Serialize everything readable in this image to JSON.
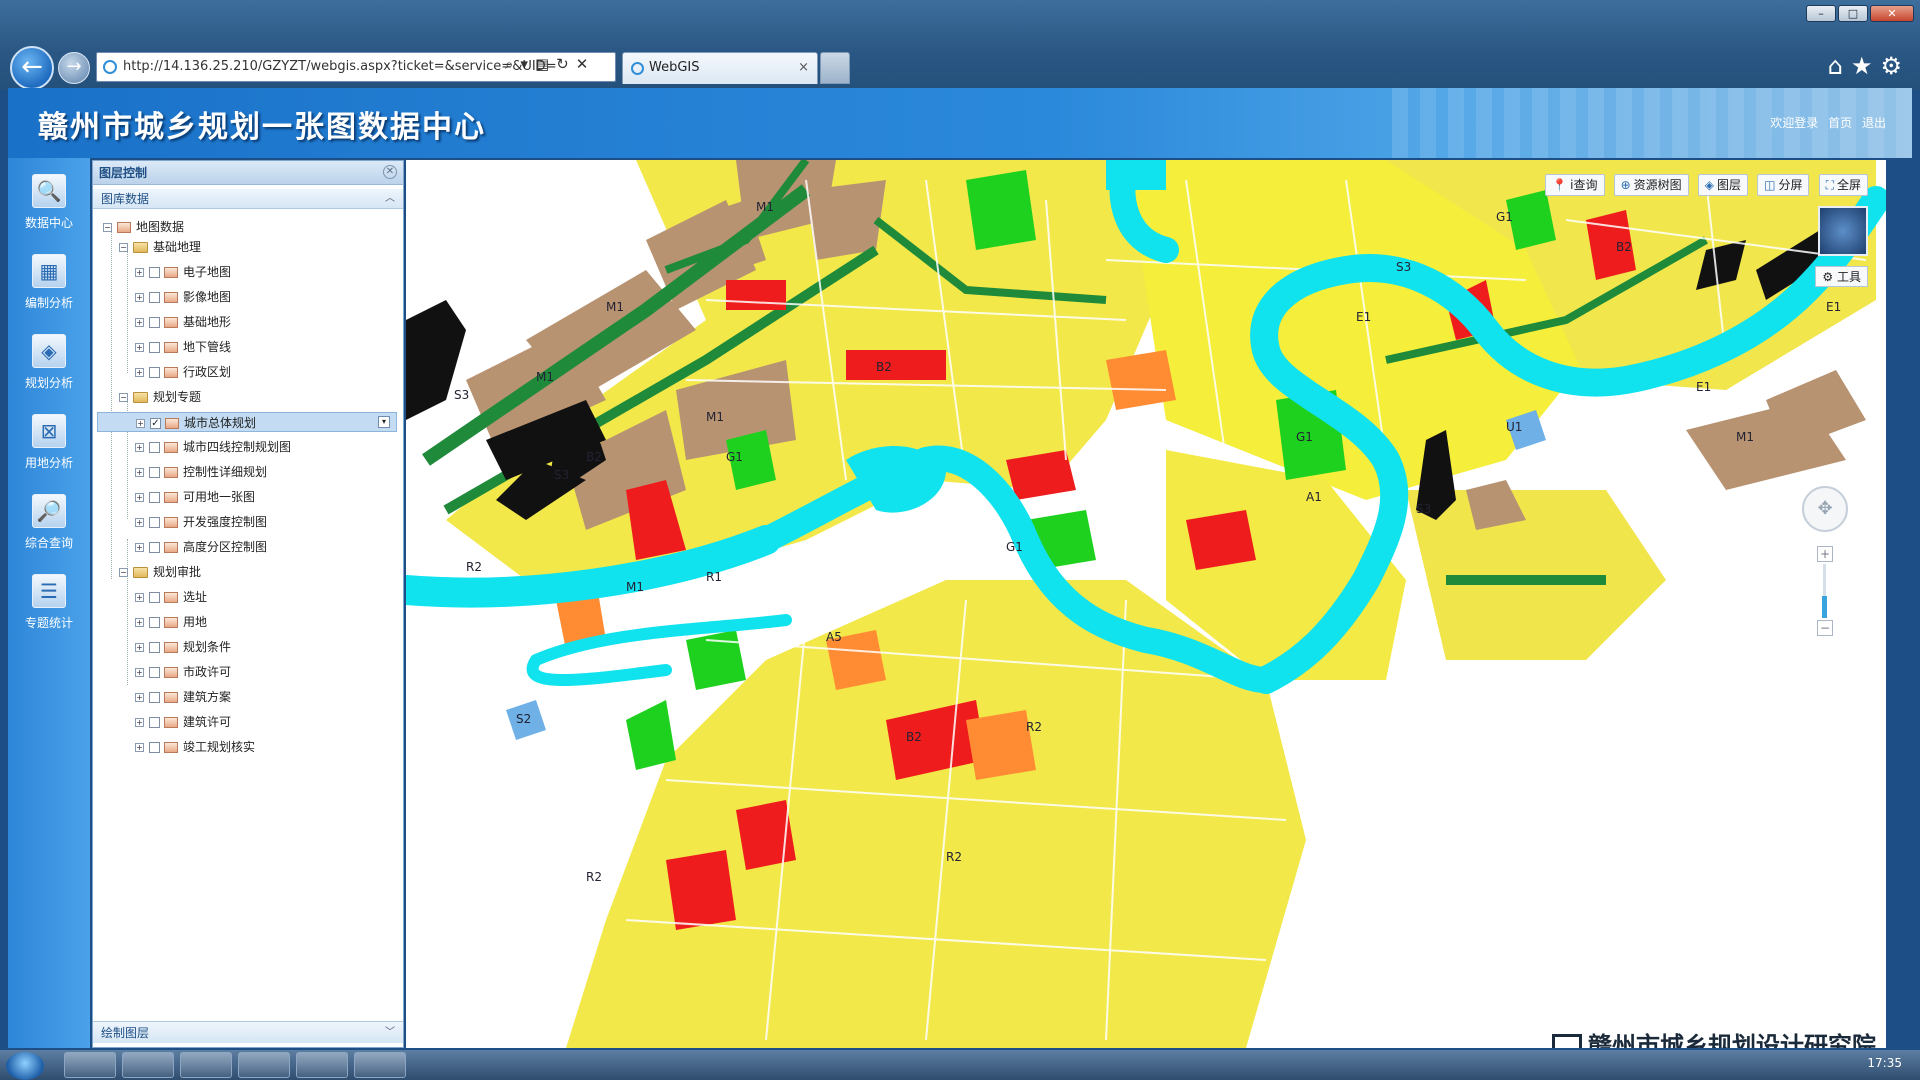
{
  "browser": {
    "url": "http://14.136.25.210/GZYZT/webgis.aspx?ticket=&service=&UID=",
    "tab_title": "WebGIS",
    "window_controls": [
      "–",
      "□",
      "✕"
    ]
  },
  "app": {
    "title": "赣州市城乡规划一张图数据中心",
    "header_links": {
      "welcome": "欢迎登录",
      "home": "首页",
      "logout": "退出"
    }
  },
  "left_toolbar": [
    {
      "label": "数据中心",
      "icon": "data-center-icon"
    },
    {
      "label": "编制分析",
      "icon": "compile-analysis-icon"
    },
    {
      "label": "规划分析",
      "icon": "planning-analysis-icon"
    },
    {
      "label": "用地分析",
      "icon": "land-analysis-icon"
    },
    {
      "label": "综合查询",
      "icon": "query-icon"
    },
    {
      "label": "专题统计",
      "icon": "statistics-icon"
    }
  ],
  "layer_panel": {
    "title": "图层控制",
    "section_data": "图库数据",
    "section_draw": "绘制图层",
    "tree": [
      {
        "label": "地图数据",
        "level": 0,
        "type": "root"
      },
      {
        "label": "基础地理",
        "level": 1,
        "type": "folder"
      },
      {
        "label": "电子地图",
        "level": 2,
        "type": "layer",
        "checked": false
      },
      {
        "label": "影像地图",
        "level": 2,
        "type": "layer",
        "checked": false
      },
      {
        "label": "基础地形",
        "level": 2,
        "type": "layer",
        "checked": false
      },
      {
        "label": "地下管线",
        "level": 2,
        "type": "layer",
        "checked": false
      },
      {
        "label": "行政区划",
        "level": 2,
        "type": "layer",
        "checked": false
      },
      {
        "label": "规划专题",
        "level": 1,
        "type": "folder"
      },
      {
        "label": "城市总体规划",
        "level": 2,
        "type": "layer",
        "checked": true,
        "selected": true
      },
      {
        "label": "城市四线控制规划图",
        "level": 2,
        "type": "layer",
        "checked": false
      },
      {
        "label": "控制性详细规划",
        "level": 2,
        "type": "layer",
        "checked": false
      },
      {
        "label": "可用地一张图",
        "level": 2,
        "type": "layer",
        "checked": false
      },
      {
        "label": "开发强度控制图",
        "level": 2,
        "type": "layer",
        "checked": false
      },
      {
        "label": "高度分区控制图",
        "level": 2,
        "type": "layer",
        "checked": false
      },
      {
        "label": "规划审批",
        "level": 1,
        "type": "folder"
      },
      {
        "label": "选址",
        "level": 2,
        "type": "layer",
        "checked": false
      },
      {
        "label": "用地",
        "level": 2,
        "type": "layer",
        "checked": false
      },
      {
        "label": "规划条件",
        "level": 2,
        "type": "layer",
        "checked": false
      },
      {
        "label": "市政许可",
        "level": 2,
        "type": "layer",
        "checked": false
      },
      {
        "label": "建筑方案",
        "level": 2,
        "type": "layer",
        "checked": false
      },
      {
        "label": "建筑许可",
        "level": 2,
        "type": "layer",
        "checked": false
      },
      {
        "label": "竣工规划核实",
        "level": 2,
        "type": "layer",
        "checked": false
      }
    ]
  },
  "map": {
    "tools": [
      {
        "label": "i查询",
        "icon": "info-icon"
      },
      {
        "label": "资源树图",
        "icon": "tree-icon"
      },
      {
        "label": "图层",
        "icon": "layers-icon"
      },
      {
        "label": "分屏",
        "icon": "split-icon"
      },
      {
        "label": "全屏",
        "icon": "fullscreen-icon"
      }
    ],
    "tool_button": "工具",
    "zoom_in": "+",
    "zoom_out": "−",
    "watermark": "赣州市城乡规划设计研究院",
    "zone_labels": [
      "R2",
      "M1",
      "M1",
      "M1",
      "M1",
      "M1",
      "M1",
      "S3",
      "S3",
      "S3",
      "S3",
      "B2",
      "B2",
      "B2",
      "B2",
      "G1",
      "G1",
      "G1",
      "G1",
      "A1",
      "E1",
      "E1",
      "E1",
      "U1",
      "S2",
      "R1",
      "R2",
      "R2",
      "R2",
      "A5"
    ],
    "colors": {
      "residential": "#ffff00",
      "commercial": "#ff0000",
      "industrial": "#b08a64",
      "green": "#00cc00",
      "water": "#00e5ee",
      "transport": "#000000",
      "admin": "#ff8040",
      "dark_green": "#1f8a3a"
    }
  },
  "taskbar": {
    "clock": "17:35"
  }
}
